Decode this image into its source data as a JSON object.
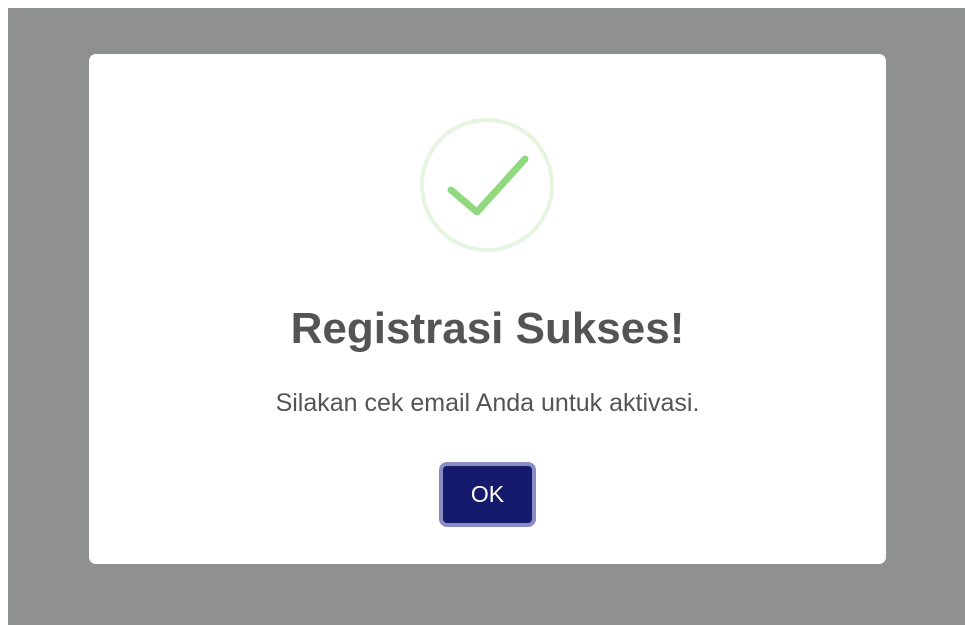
{
  "dialog": {
    "icon": "success-checkmark-icon",
    "title": "Registrasi Sukses!",
    "message": "Silakan cek email Anda untuk aktivasi.",
    "ok_label": "OK"
  },
  "colors": {
    "overlay": "#8f9190",
    "dialog_background": "#ffffff",
    "icon_check": "#90d97e",
    "icon_ring": "#e6f5df",
    "text": "#545454",
    "button_background": "#161a6c",
    "button_focus_ring": "#8a8cc4"
  }
}
